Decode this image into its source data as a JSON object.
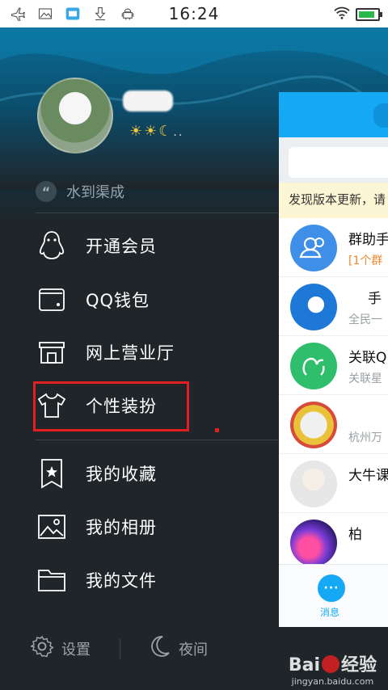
{
  "status_bar": {
    "time": "16:24",
    "left_icons": [
      "airplane-icon",
      "image-icon",
      "app-icon",
      "download-icon",
      "android-icon"
    ],
    "right_icons": [
      "wifi-icon",
      "battery-icon"
    ],
    "battery_level": 0.9
  },
  "profile": {
    "level_icons": "☀☀☾",
    "level_more": "..",
    "signature": "水到渠成"
  },
  "menu": {
    "items": [
      {
        "label": "开通会员",
        "icon": "penguin-icon"
      },
      {
        "label": "QQ钱包",
        "icon": "wallet-icon"
      },
      {
        "label": "网上营业厅",
        "icon": "store-icon"
      },
      {
        "label": "个性装扮",
        "icon": "tshirt-icon"
      },
      {
        "label": "我的收藏",
        "icon": "bookmark-star-icon"
      },
      {
        "label": "我的相册",
        "icon": "photo-icon"
      },
      {
        "label": "我的文件",
        "icon": "folder-icon"
      }
    ]
  },
  "bottom": {
    "settings_label": "设置",
    "night_label": "夜间"
  },
  "main_panel": {
    "notice": "发现版本更新，请",
    "conversations": [
      {
        "title": "群助手",
        "subtitle": "[1个群"
      },
      {
        "title": "手",
        "subtitle": "全民一"
      },
      {
        "title": "关联Q",
        "subtitle": "关联星"
      },
      {
        "title": "",
        "subtitle": "杭州万"
      },
      {
        "title": "大牛课",
        "subtitle": ""
      },
      {
        "title": "柏",
        "subtitle": ""
      }
    ],
    "tab_label": "消息",
    "tab_icon_text": "···"
  },
  "watermark": {
    "brand_left": "Bai",
    "brand_right": "经验",
    "url": "jingyan.baidu.com"
  },
  "colors": {
    "accent": "#15a8f5",
    "highlight": "#e02020",
    "drawer_bg": "#1f2529"
  }
}
